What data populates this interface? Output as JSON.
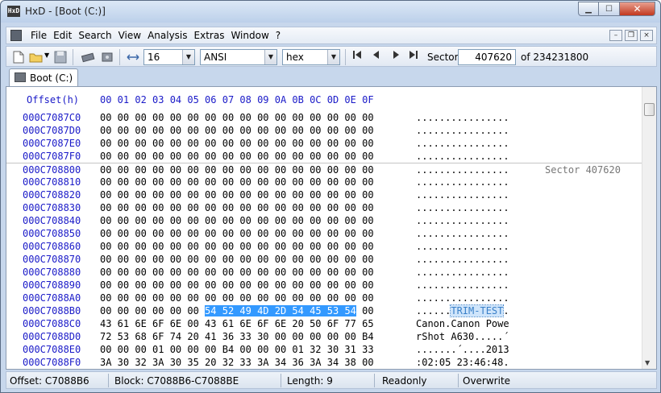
{
  "window": {
    "app_icon": "HxD",
    "title": "HxD - [Boot (C:)]",
    "min": "▁",
    "max": "☐",
    "close": "✕"
  },
  "menu": {
    "items": [
      "File",
      "Edit",
      "Search",
      "View",
      "Analysis",
      "Extras",
      "Window",
      "?"
    ],
    "mdi_min": "–",
    "mdi_restore": "❐",
    "mdi_close": "×"
  },
  "toolbar": {
    "bytes_per_row": "16",
    "charset": "ANSI",
    "offset_base": "hex",
    "sector_label": "Sector",
    "sector_value": "407620",
    "sector_total": "of 234231800",
    "icons": [
      "new-file-icon",
      "open-file-icon",
      "save-icon",
      "ram-icon",
      "disk-icon",
      "column-width-icon",
      "first-icon",
      "prev-icon",
      "next-icon",
      "last-icon"
    ]
  },
  "tab": {
    "label": "Boot (C:)"
  },
  "editor": {
    "header_offset": "Offset(h)",
    "header_cols": "00 01 02 03 04 05 06 07 08 09 0A 0B 0C 0D 0E 0F",
    "sector_note": "Sector 407620",
    "rows": [
      {
        "offset": "000C7087C0",
        "hex": "00 00 00 00 00 00 00 00 00 00 00 00 00 00 00 00",
        "ascii": "................"
      },
      {
        "offset": "000C7087D0",
        "hex": "00 00 00 00 00 00 00 00 00 00 00 00 00 00 00 00",
        "ascii": "................"
      },
      {
        "offset": "000C7087E0",
        "hex": "00 00 00 00 00 00 00 00 00 00 00 00 00 00 00 00",
        "ascii": "................"
      },
      {
        "offset": "000C7087F0",
        "hex": "00 00 00 00 00 00 00 00 00 00 00 00 00 00 00 00",
        "ascii": "................"
      },
      {
        "offset": "000C708800",
        "hex": "00 00 00 00 00 00 00 00 00 00 00 00 00 00 00 00",
        "ascii": "................"
      },
      {
        "offset": "000C708810",
        "hex": "00 00 00 00 00 00 00 00 00 00 00 00 00 00 00 00",
        "ascii": "................"
      },
      {
        "offset": "000C708820",
        "hex": "00 00 00 00 00 00 00 00 00 00 00 00 00 00 00 00",
        "ascii": "................"
      },
      {
        "offset": "000C708830",
        "hex": "00 00 00 00 00 00 00 00 00 00 00 00 00 00 00 00",
        "ascii": "................"
      },
      {
        "offset": "000C708840",
        "hex": "00 00 00 00 00 00 00 00 00 00 00 00 00 00 00 00",
        "ascii": "................"
      },
      {
        "offset": "000C708850",
        "hex": "00 00 00 00 00 00 00 00 00 00 00 00 00 00 00 00",
        "ascii": "................"
      },
      {
        "offset": "000C708860",
        "hex": "00 00 00 00 00 00 00 00 00 00 00 00 00 00 00 00",
        "ascii": "................"
      },
      {
        "offset": "000C708870",
        "hex": "00 00 00 00 00 00 00 00 00 00 00 00 00 00 00 00",
        "ascii": "................"
      },
      {
        "offset": "000C708880",
        "hex": "00 00 00 00 00 00 00 00 00 00 00 00 00 00 00 00",
        "ascii": "................"
      },
      {
        "offset": "000C708890",
        "hex": "00 00 00 00 00 00 00 00 00 00 00 00 00 00 00 00",
        "ascii": "................"
      },
      {
        "offset": "000C7088A0",
        "hex": "00 00 00 00 00 00 00 00 00 00 00 00 00 00 00 00",
        "ascii": "................"
      },
      {
        "offset": "000C7088B0",
        "hex_pre": "00 00 00 00 00 00 ",
        "hex_sel": "54 52 49 4D 2D 54 45 53 54",
        "hex_post": " 00",
        "ascii_pre": "......",
        "ascii_sel": "TRIM-TEST",
        "ascii_post": "."
      },
      {
        "offset": "000C7088C0",
        "hex": "43 61 6E 6F 6E 00 43 61 6E 6F 6E 20 50 6F 77 65",
        "ascii": "Canon.Canon Powe"
      },
      {
        "offset": "000C7088D0",
        "hex": "72 53 68 6F 74 20 41 36 33 30 00 00 00 00 00 B4",
        "ascii": "rShot A630.....´"
      },
      {
        "offset": "000C7088E0",
        "hex": "00 00 00 01 00 00 00 B4 00 00 00 01 32 30 31 33",
        "ascii": ".......´....2013"
      },
      {
        "offset": "000C7088F0",
        "hex": "3A 30 32 3A 30 35 20 32 33 3A 34 36 3A 34 38 00",
        "ascii": ":02:05 23:46:48."
      }
    ]
  },
  "status": {
    "offset": "Offset: C7088B6",
    "block": "Block: C7088B6-C7088BE",
    "length": "Length: 9",
    "mode1": "Readonly",
    "mode2": "Overwrite"
  },
  "colors": {
    "offset_blue": "#1a1ac8",
    "selection": "#3399ff",
    "chrome": "#c7d7ec"
  }
}
